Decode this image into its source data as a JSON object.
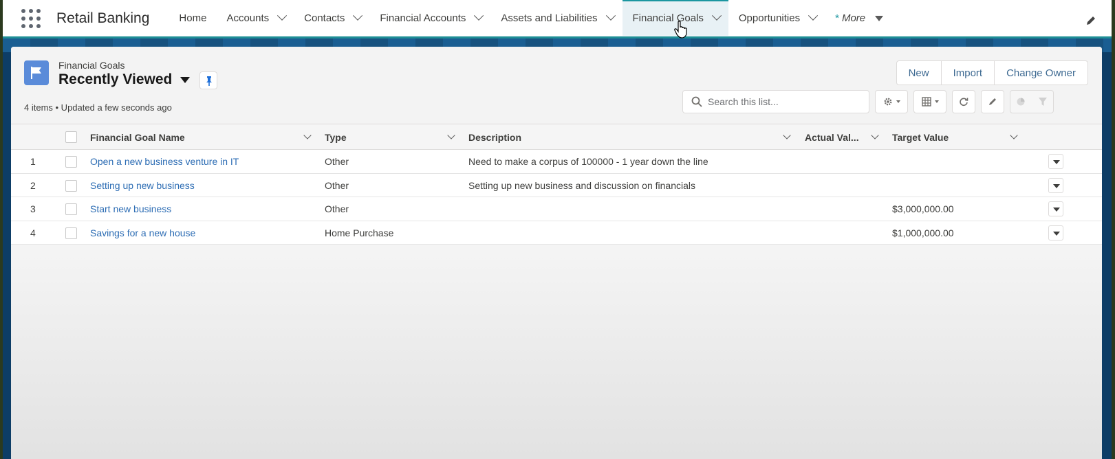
{
  "app": {
    "name": "Retail Banking"
  },
  "nav": {
    "items": [
      {
        "label": "Home",
        "has_dropdown": false
      },
      {
        "label": "Accounts",
        "has_dropdown": true
      },
      {
        "label": "Contacts",
        "has_dropdown": true
      },
      {
        "label": "Financial Accounts",
        "has_dropdown": true
      },
      {
        "label": "Assets and Liabilities",
        "has_dropdown": true
      },
      {
        "label": "Financial Goals",
        "has_dropdown": true,
        "active": true
      },
      {
        "label": "Opportunities",
        "has_dropdown": true
      }
    ],
    "more_asterisk": "*",
    "more_label": "More"
  },
  "list": {
    "object_label": "Financial Goals",
    "view_name": "Recently Viewed",
    "meta": "4 items • Updated a few seconds ago",
    "buttons": {
      "new": "New",
      "import": "Import",
      "change_owner": "Change Owner"
    },
    "search_placeholder": "Search this list..."
  },
  "table": {
    "columns": {
      "name": "Financial Goal Name",
      "type": "Type",
      "description": "Description",
      "actual": "Actual Val...",
      "target": "Target Value"
    },
    "rows": [
      {
        "num": "1",
        "name": "Open a new business venture in IT",
        "type": "Other",
        "description": "Need to make a corpus of 100000 - 1 year down the line",
        "actual": "",
        "target": ""
      },
      {
        "num": "2",
        "name": "Setting up new business",
        "type": "Other",
        "description": "Setting up new business and discussion on financials",
        "actual": "",
        "target": ""
      },
      {
        "num": "3",
        "name": "Start new business",
        "type": "Other",
        "description": "",
        "actual": "",
        "target": "$3,000,000.00"
      },
      {
        "num": "4",
        "name": "Savings for a new house",
        "type": "Home Purchase",
        "description": "",
        "actual": "",
        "target": "$1,000,000.00"
      }
    ]
  },
  "colors": {
    "accent": "#1b96a0",
    "link": "#2d6db4",
    "object_icon": "#5a8bd9",
    "pin": "#1e6fd9"
  }
}
